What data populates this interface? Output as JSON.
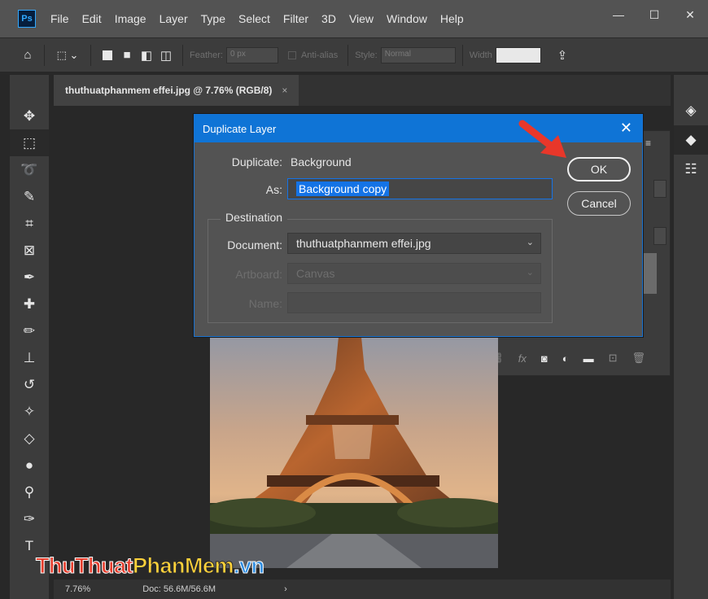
{
  "app": {
    "logo": "Ps"
  },
  "menu": [
    "File",
    "Edit",
    "Image",
    "Layer",
    "Type",
    "Select",
    "Filter",
    "3D",
    "View",
    "Window",
    "Help"
  ],
  "window_controls": {
    "minimize": "—",
    "maximize": "☐",
    "close": "✕"
  },
  "options_bar": {
    "feather_label": "Feather:",
    "feather_value": "0 px",
    "antialias_label": "Anti-alias",
    "style_label": "Style:",
    "style_value": "Normal",
    "width_label": "Width"
  },
  "document_tab": {
    "title": "thuthuatphanmem effei.jpg @ 7.76% (RGB/8)",
    "close": "×"
  },
  "status_bar": {
    "zoom": "7.76%",
    "doc": "Doc: 56.6M/56.6M",
    "arrow": "›"
  },
  "dialog": {
    "title": "Duplicate Layer",
    "close": "✕",
    "duplicate_label": "Duplicate:",
    "duplicate_value": "Background",
    "as_label": "As:",
    "as_value": "Background copy",
    "destination_legend": "Destination",
    "document_label": "Document:",
    "document_value": "thuthuatphanmem effei.jpg",
    "artboard_label": "Artboard:",
    "artboard_value": "Canvas",
    "name_label": "Name:",
    "name_value": "",
    "ok_label": "OK",
    "cancel_label": "Cancel"
  },
  "watermark": {
    "part1": "ThuThuat",
    "part2": "PhanMem",
    "part3": ".vn"
  },
  "colors": {
    "accent": "#1473e6",
    "title_bar": "#0f74d6",
    "arrow": "#e8372a"
  }
}
